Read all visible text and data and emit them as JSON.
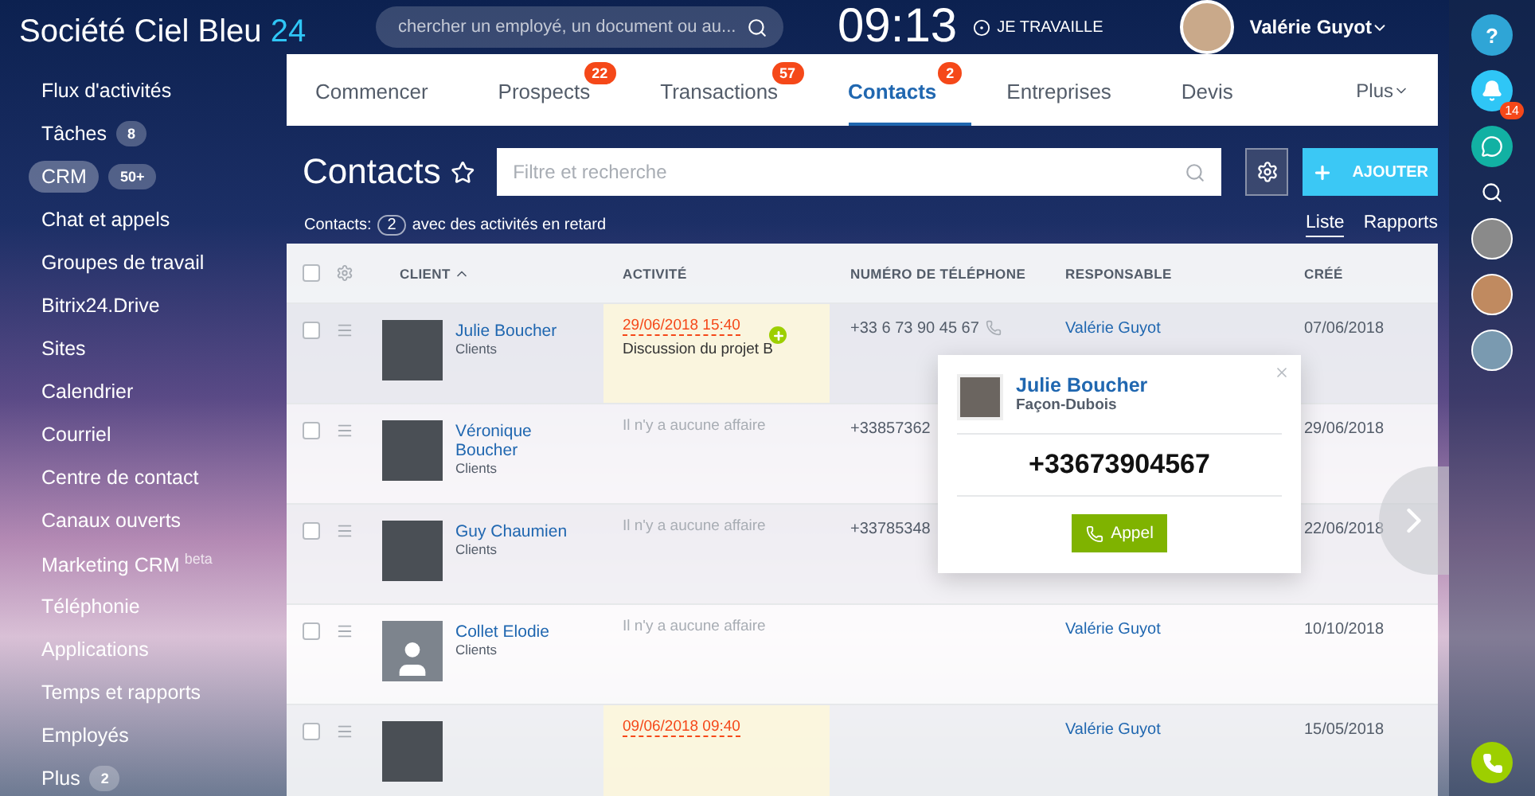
{
  "header": {
    "logo_text": "Société Ciel Bleu",
    "logo_suffix": "24",
    "search": {
      "placeholder": "chercher un employé, un document ou au..."
    },
    "clock": "09:13",
    "work_status": "JE TRAVAILLE",
    "user": "Valérie Guyot"
  },
  "sidebar": {
    "items": [
      {
        "label": "Flux d'activités",
        "selected": false
      },
      {
        "label": "Tâches",
        "badge": "8",
        "selected": false
      },
      {
        "label": "CRM",
        "badge": "50+",
        "selected": true
      },
      {
        "label": "Chat et appels",
        "selected": false
      },
      {
        "label": "Groupes de travail",
        "selected": false
      },
      {
        "label": "Bitrix24.Drive",
        "selected": false
      },
      {
        "label": "Sites",
        "selected": false
      },
      {
        "label": "Calendrier",
        "selected": false
      },
      {
        "label": "Courriel",
        "selected": false
      },
      {
        "label": "Centre de contact",
        "selected": false
      },
      {
        "label": "Canaux ouverts",
        "selected": false
      },
      {
        "label": "Marketing CRM",
        "superscript": "beta",
        "selected": false
      },
      {
        "label": "Téléphonie",
        "selected": false
      },
      {
        "label": "Applications",
        "selected": false
      },
      {
        "label": "Temps et rapports",
        "selected": false
      },
      {
        "label": "Employés",
        "selected": false
      },
      {
        "label": "Plus",
        "badge": "2",
        "selected": false
      }
    ]
  },
  "tabs": [
    {
      "label": "Commencer",
      "selected": false
    },
    {
      "label": "Prospects",
      "badge": "22",
      "selected": false
    },
    {
      "label": "Transactions",
      "badge": "57",
      "selected": false
    },
    {
      "label": "Contacts",
      "badge": "2",
      "selected": true
    },
    {
      "label": "Entreprises",
      "selected": false
    },
    {
      "label": "Devis",
      "selected": false
    }
  ],
  "more_tab": "Plus",
  "page": {
    "title": "Contacts",
    "filter": {
      "placeholder": "Filtre et recherche"
    },
    "add_button": "AJOUTER"
  },
  "summary": {
    "label": "Contacts:",
    "count": "2",
    "text": "avec des activités en retard"
  },
  "views": [
    {
      "label": "Liste",
      "selected": true
    },
    {
      "label": "Rapports",
      "selected": false
    }
  ],
  "table": {
    "all_checked": false,
    "columns": [
      {
        "label": "CLIENT",
        "sorted": true
      },
      {
        "label": "ACTIVITÉ",
        "sorted": false
      },
      {
        "label": "NUMÉRO DE TÉLÉPHONE",
        "sorted": false
      },
      {
        "label": "RESPONSABLE",
        "sorted": false
      },
      {
        "label": "CRÉÉ",
        "sorted": false
      }
    ],
    "rows": [
      {
        "checked": false,
        "client": "Julie Boucher",
        "type": "Clients",
        "photo": true,
        "activity": {
          "kind": "deal",
          "date": "29/06/2018 15:40",
          "title": "Discussion du projet B"
        },
        "phone": "+33 6 73 90 45 67",
        "call_icon": true,
        "responsable": "Valérie Guyot",
        "created": "07/06/2018"
      },
      {
        "checked": false,
        "client": "Véronique Boucher",
        "type": "Clients",
        "photo": true,
        "activity": {
          "kind": "none",
          "text": "Il n'y a aucune affaire"
        },
        "phone": "+33857362",
        "call_icon": false,
        "created": "29/06/2018"
      },
      {
        "checked": false,
        "client": "Guy Chaumien",
        "type": "Clients",
        "photo": true,
        "activity": {
          "kind": "none",
          "text": "Il n'y a aucune affaire"
        },
        "phone": "+33785348",
        "call_icon": false,
        "created": "22/06/2018"
      },
      {
        "checked": false,
        "client": "Collet Elodie",
        "type": "Clients",
        "photo": false,
        "activity": {
          "kind": "none",
          "text": "Il n'y a aucune affaire"
        },
        "call_icon": false,
        "responsable": "Valérie Guyot",
        "created": "10/10/2018"
      },
      {
        "checked": false,
        "photo": true,
        "activity": {
          "kind": "deal",
          "date": "09/06/2018 09:40"
        },
        "call_icon": false,
        "responsable": "Valérie Guyot",
        "created": "15/05/2018"
      }
    ]
  },
  "popup": {
    "name": "Julie Boucher",
    "company": "Façon-Dubois",
    "phone": "+33673904567",
    "call_button": "Appel"
  },
  "right_bar": {
    "help": "?",
    "notifications": "14"
  }
}
